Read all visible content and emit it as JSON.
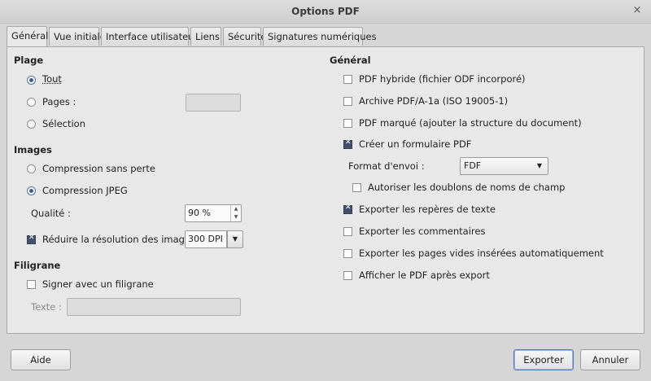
{
  "window": {
    "title": "Options PDF",
    "close_glyph": "×"
  },
  "tabs": [
    {
      "label": "Général"
    },
    {
      "label": "Vue initiale"
    },
    {
      "label": "Interface utilisateur"
    },
    {
      "label": "Liens"
    },
    {
      "label": "Sécurité"
    },
    {
      "label": "Signatures numériques"
    }
  ],
  "range": {
    "heading": "Plage",
    "all": "Tout",
    "pages": "Pages :",
    "pages_value": "",
    "selection": "Sélection"
  },
  "images": {
    "heading": "Images",
    "lossless": "Compression sans perte",
    "jpeg": "Compression JPEG",
    "quality_label": "Qualité :",
    "quality_value": "90 %",
    "reduce_label": "Réduire la résolution des images",
    "reduce_value": "300 DPI"
  },
  "watermark": {
    "heading": "Filigrane",
    "sign_label": "Signer avec un filigrane",
    "text_label": "Texte :",
    "text_value": ""
  },
  "general": {
    "heading": "Général",
    "hybrid": "PDF hybride (fichier ODF incorporé)",
    "archive": "Archive PDF/A-1a (ISO 19005-1)",
    "tagged": "PDF marqué (ajouter la structure du document)",
    "form": "Créer un formulaire PDF",
    "submit_label": "Format d'envoi :",
    "submit_value": "FDF",
    "allow_dup": "Autoriser les doublons de noms de champ",
    "bookmarks": "Exporter les repères de texte",
    "comments": "Exporter les commentaires",
    "empty_pages": "Exporter les pages vides insérées automatiquement",
    "view_after": "Afficher le PDF après export"
  },
  "buttons": {
    "help": "Aide",
    "export": "Exporter",
    "cancel": "Annuler"
  },
  "colors": {
    "accent": "#3f5c93",
    "checked": "#44506b",
    "background": "#d6d6d6"
  }
}
